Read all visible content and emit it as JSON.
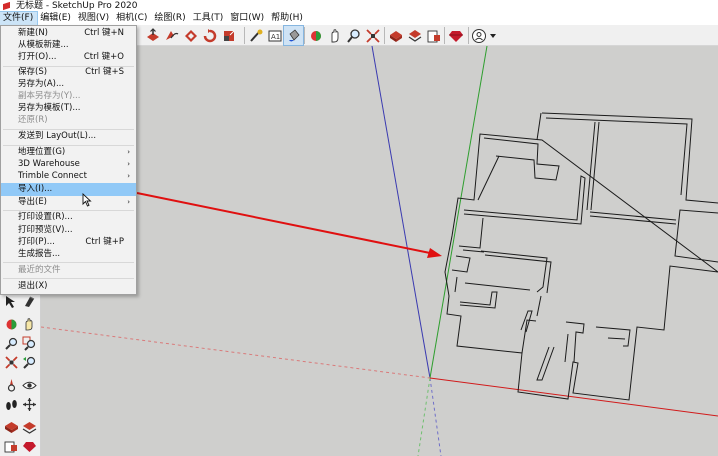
{
  "titlebar": {
    "title": "无标题 - SketchUp Pro 2020"
  },
  "menubar": {
    "items": [
      "文件(F)",
      "编辑(E)",
      "视图(V)",
      "相机(C)",
      "绘图(R)",
      "工具(T)",
      "窗口(W)",
      "帮助(H)"
    ],
    "active": "文件(F)"
  },
  "file_menu": {
    "items": [
      {
        "label": "新建(N)",
        "shortcut": "Ctrl 键+N"
      },
      {
        "label": "从模板新建..."
      },
      {
        "label": "打开(O)...",
        "shortcut": "Ctrl 键+O"
      },
      {
        "label": "保存(S)",
        "shortcut": "Ctrl 键+S"
      },
      {
        "label": "另存为(A)..."
      },
      {
        "label": "副本另存为(Y)...",
        "disabled": true
      },
      {
        "label": "另存为模板(T)..."
      },
      {
        "label": "还原(R)",
        "disabled": true
      },
      {
        "label": "发送到 LayOut(L)..."
      },
      {
        "label": "地理位置(G)",
        "submenu": true
      },
      {
        "label": "3D Warehouse",
        "submenu": true
      },
      {
        "label": "Trimble Connect",
        "submenu": true
      },
      {
        "label": "导入(I)...",
        "highlighted": true
      },
      {
        "label": "导出(E)",
        "submenu": true
      },
      {
        "label": "打印设置(R)..."
      },
      {
        "label": "打印预览(V)..."
      },
      {
        "label": "打印(P)...",
        "shortcut": "Ctrl 键+P"
      },
      {
        "label": "生成报告..."
      },
      {
        "label": "最近的文件",
        "disabled": true
      },
      {
        "label": "退出(X)"
      }
    ],
    "submenu_arrow": "›"
  },
  "toolbar": {
    "tools": [
      "push-pull-icon",
      "follow-me-icon",
      "offset-icon",
      "rotate-icon",
      "scale-icon",
      "tape-measure-icon",
      "text-icon",
      "paint-bucket-icon",
      "orbit-icon",
      "zoom-icon",
      "zoom-extents-icon",
      "warehouse-icon",
      "extension-warehouse-icon",
      "layout-icon",
      "ruby-icon",
      "account-icon"
    ],
    "pressed_tool": "paint-bucket-icon"
  },
  "left_toolbar": {
    "tools": [
      "select-icon",
      "eraser-icon",
      "orbit-icon",
      "pan-icon",
      "zoom-icon",
      "zoom-window-icon",
      "zoom-extents-icon",
      "previous-view-icon",
      "position-camera-icon",
      "look-around-icon",
      "walk-icon",
      "section-plane-icon",
      "warehouse-icon",
      "extension-warehouse-icon"
    ]
  },
  "colors": {
    "viewport_bg": "#cfcfcd",
    "axis_red": "#d11a1a",
    "axis_green": "#2e9e2e",
    "axis_blue": "#3a3ab0",
    "annotation_arrow": "#e01010",
    "menu_highlight": "#91c9f7"
  }
}
